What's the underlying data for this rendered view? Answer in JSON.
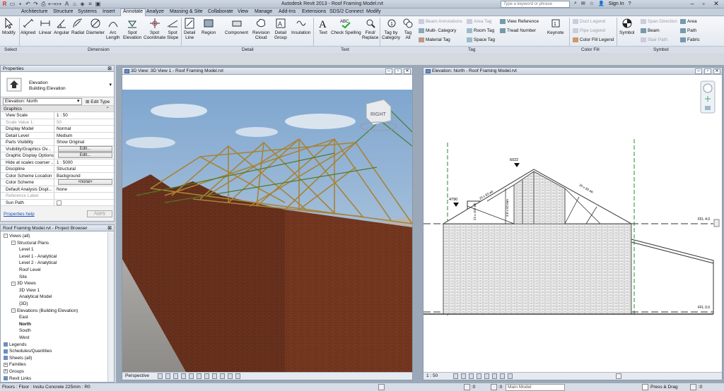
{
  "app": {
    "window_title": "Autodesk Revit 2013 -",
    "file_title": "Roof Framing Model.rvt",
    "search_placeholder": "Type a keyword or phrase",
    "sign_in": "Sign In"
  },
  "tabs": [
    "Architecture",
    "Structure",
    "Systems",
    "Insert",
    "Annotate",
    "Analyze",
    "Massing & Site",
    "Collaborate",
    "View",
    "Manage",
    "Add-Ins",
    "Extensions",
    "SDS/2 Connect",
    "Modify"
  ],
  "active_tab": "Annotate",
  "ribbon": {
    "modify": "Modify",
    "aligned": "Aligned",
    "linear": "Linear",
    "angular": "Angular",
    "radial": "Radial",
    "diameter": "Diameter",
    "arc_length_1": "Arc",
    "arc_length_2": "Length",
    "spot_elev_1": "Spot",
    "spot_elev_2": "Elevation",
    "spot_coord_1": "Spot",
    "spot_coord_2": "Coordinate",
    "spot_slope_1": "Spot",
    "spot_slope_2": "Slope",
    "detail_line_1": "Detail",
    "detail_line_2": "Line",
    "region": "Region",
    "component": "Component",
    "rev_cloud_1": "Revision",
    "rev_cloud_2": "Cloud",
    "detail_group_1": "Detail",
    "detail_group_2": "Group",
    "insulation": "Insulation",
    "text": "Text",
    "check_spelling": "Check Spelling",
    "find_replace_1": "Find/",
    "find_replace_2": "Replace",
    "tag_by_cat_1": "Tag by",
    "tag_by_cat_2": "Category",
    "tag_all_1": "Tag",
    "tag_all_2": "All",
    "beam_annotations": "Beam Annotations",
    "multi_category": "Multi- Category",
    "material_tag": "Material Tag",
    "area_tag": "Area Tag",
    "room_tag": "Room Tag",
    "space_tag": "Space Tag",
    "view_reference": "View Reference",
    "tread_number": "Tread Number",
    "keynote": "Keynote",
    "duct_legend": "Duct Legend",
    "pipe_legend": "Pipe Legend",
    "color_fill_legend": "Color Fill Legend",
    "symbol": "Symbol",
    "span_direction": "Span Direction",
    "beam": "Beam",
    "stair_path": "Stair Path",
    "area": "Area",
    "path": "Path",
    "fabric": "Fabric"
  },
  "groups": {
    "select": "Select",
    "dimension": "Dimension",
    "detail": "Detail",
    "text": "Text",
    "tag": "Tag",
    "color_fill": "Color Fill",
    "symbol": "Symbol"
  },
  "properties": {
    "title": "Properties",
    "type_line1": "Elevation",
    "type_line2": "Building Elevation",
    "instance_selector": "Elevation: North",
    "edit_type": "Edit Type",
    "group_graphics": "Graphics",
    "rows": [
      {
        "k": "View Scale",
        "v": "1 : 50",
        "dis": false,
        "btn": false
      },
      {
        "k": "Scale Value    1:",
        "v": "50",
        "dis": true,
        "btn": false
      },
      {
        "k": "Display Model",
        "v": "Normal",
        "dis": false,
        "btn": false
      },
      {
        "k": "Detail Level",
        "v": "Medium",
        "dis": false,
        "btn": false
      },
      {
        "k": "Parts Visibility",
        "v": "Show Original",
        "dis": false,
        "btn": false
      },
      {
        "k": "Visibility/Graphics Ov...",
        "v": "Edit...",
        "dis": false,
        "btn": true
      },
      {
        "k": "Graphic Display Options",
        "v": "Edit...",
        "dis": false,
        "btn": true
      },
      {
        "k": "Hide at scales coarser ...",
        "v": "1 : 5000",
        "dis": false,
        "btn": false
      },
      {
        "k": "Discipline",
        "v": "Structural",
        "dis": false,
        "btn": false
      },
      {
        "k": "Color Scheme Location",
        "v": "Background",
        "dis": false,
        "btn": false
      },
      {
        "k": "Color Scheme",
        "v": "<none>",
        "dis": false,
        "btn": true
      },
      {
        "k": "Default Analysis Displ...",
        "v": "None",
        "dis": false,
        "btn": false
      },
      {
        "k": "Reference Label",
        "v": "",
        "dis": true,
        "btn": false
      },
      {
        "k": "Sun Path",
        "v": "",
        "dis": false,
        "btn": false
      }
    ],
    "help": "Properties help",
    "apply": "Apply"
  },
  "browser": {
    "title": "Roof Framing Model.rvt - Project Browser",
    "nodes": [
      {
        "label": "Views (all)",
        "lvl": 0,
        "tg": "-",
        "bold": false
      },
      {
        "label": "Structural Plans",
        "lvl": 1,
        "tg": "-",
        "bold": false
      },
      {
        "label": "Level 1",
        "lvl": 2,
        "tg": "",
        "bold": false
      },
      {
        "label": "Level 1 - Analytical",
        "lvl": 2,
        "tg": "",
        "bold": false
      },
      {
        "label": "Level 2 - Analytical",
        "lvl": 2,
        "tg": "",
        "bold": false
      },
      {
        "label": "Roof Level",
        "lvl": 2,
        "tg": "",
        "bold": false
      },
      {
        "label": "Site",
        "lvl": 2,
        "tg": "",
        "bold": false
      },
      {
        "label": "3D Views",
        "lvl": 1,
        "tg": "-",
        "bold": false
      },
      {
        "label": "3D View 1",
        "lvl": 2,
        "tg": "",
        "bold": false
      },
      {
        "label": "Analytical Model",
        "lvl": 2,
        "tg": "",
        "bold": false
      },
      {
        "label": "{3D}",
        "lvl": 2,
        "tg": "",
        "bold": false
      },
      {
        "label": "Elevations (Building Elevation)",
        "lvl": 1,
        "tg": "-",
        "bold": false
      },
      {
        "label": "East",
        "lvl": 2,
        "tg": "",
        "bold": false
      },
      {
        "label": "North",
        "lvl": 2,
        "tg": "",
        "bold": true
      },
      {
        "label": "South",
        "lvl": 2,
        "tg": "",
        "bold": false
      },
      {
        "label": "West",
        "lvl": 2,
        "tg": "",
        "bold": false
      },
      {
        "label": "Legends",
        "lvl": 0,
        "tg": "",
        "bold": false
      },
      {
        "label": "Schedules/Quantities",
        "lvl": 0,
        "tg": "",
        "bold": false
      },
      {
        "label": "Sheets (all)",
        "lvl": 0,
        "tg": "",
        "bold": false
      },
      {
        "label": "Families",
        "lvl": 0,
        "tg": "+",
        "bold": false
      },
      {
        "label": "Groups",
        "lvl": 0,
        "tg": "+",
        "bold": false
      },
      {
        "label": "Revit Links",
        "lvl": 0,
        "tg": "",
        "bold": false
      }
    ]
  },
  "view3d": {
    "title": "3D View: 3D View 1 - Roof Framing Model.rvt",
    "cube_label": "RIGHT",
    "bar_label": "Perspective"
  },
  "viewElev": {
    "title": "Elevation: North - Roof Framing Model.rvt",
    "bar_label": "1 : 50",
    "tag_top": "6022",
    "tag_left": "4790",
    "ffl_top": "FFL 4.0",
    "ffl_bottom": "FFL 0.0",
    "dim_a": "25 x 83 wb",
    "dim_b": "22 x 102 wb",
    "dim_c": "3.0 x 92 mm"
  },
  "status": {
    "text": "Floors : Floor : Insitu Concrete 225mm : R0",
    "count1": ":0",
    "count2": ":0",
    "model": "Main Model",
    "press_drag": "Press & Drag",
    "filter": ":0"
  },
  "colors": {
    "brick": "#7a3a22",
    "timber": "#b08a3a",
    "sky": "#8fb2d6",
    "ui_panel": "#d4d9e0"
  }
}
